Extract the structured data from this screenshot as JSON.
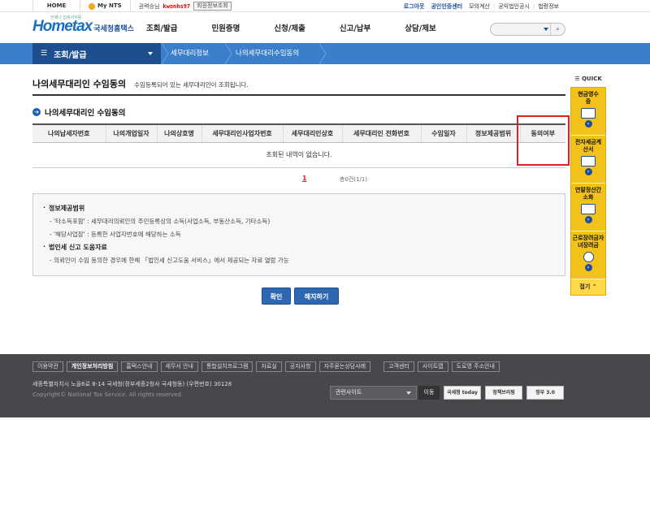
{
  "topbar": {
    "home": "HOME",
    "mynts": "My NTS",
    "user_prefix": "권력승님",
    "user_id": "kwonhs97",
    "member_info": "회원정보조회",
    "links": [
      "로그아웃",
      "공인인증센터",
      "모의계산",
      "공익법인공시",
      "법령정보"
    ]
  },
  "header": {
    "logo_main": "Hometax",
    "logo_kor": "국세청홈택스",
    "logo_tag": "언제나 집에서처럼",
    "gnb": [
      "조회/발급",
      "민원증명",
      "신청/제출",
      "신고/납부",
      "상담/제보"
    ]
  },
  "navbar": {
    "menu": "조회/발급",
    "crumbs": [
      "세무대리정보",
      "나의세무대리수임동의"
    ]
  },
  "page": {
    "title": "나의세무대리인 수임동의",
    "desc": "수임등록되어 있는 세무대리인이 조회됩니다.",
    "section": "나의세무대리인 수임동의"
  },
  "table": {
    "columns": [
      "나의납세자번호",
      "나의개업일자",
      "나의상호명",
      "세무대리인사업자번호",
      "세무대리인상호",
      "세무대리인 전화번호",
      "수임일자",
      "정보제공범위",
      "동의여부"
    ],
    "empty": "조회된 내역이 없습니다."
  },
  "paging": {
    "current": "1",
    "count": "총0건(1/1)"
  },
  "info": {
    "h1": "정보제공범위",
    "l1": "- '타소득포함' : 세무대리의뢰인의 주민등록상의 소득(사업소득, 부동산소득, 기타소득)",
    "l2": "- '해당사업장' : 등록한 사업자번호에 해당하는 소득",
    "h2": "법인세 신고 도움자료",
    "l3": "- 의뢰인이 수임 동의한 경우에 한해 「법인세 신고도움 서비스」에서 제공되는 자료 열람 가능"
  },
  "buttons": {
    "confirm": "확인",
    "cancel": "해지하기"
  },
  "quick": {
    "title": "QUICK",
    "items": [
      "현금영수증",
      "전자세금계산서",
      "연말정산간소화",
      "근로장려금자녀장려금"
    ],
    "close": "접기"
  },
  "footer": {
    "links": [
      "이용약관",
      "개인정보처리방침",
      "홈택스안내",
      "세무서 안내",
      "통합설치프로그램",
      "자료실",
      "공지사항",
      "자주묻는상담사례",
      "고객센터",
      "사이트맵",
      "도로명 주소안내"
    ],
    "address": "세종특별자치시 노을6로 8-14 국세청(정부세종2청사 국세청동) (우편번호) 30128",
    "copyright": "Copyright© National Tax Service. All rights reserved.",
    "related": "관련사이트",
    "go": "이동",
    "banners": [
      "국세청 today",
      "정책브리핑",
      "정부 3.0"
    ]
  }
}
